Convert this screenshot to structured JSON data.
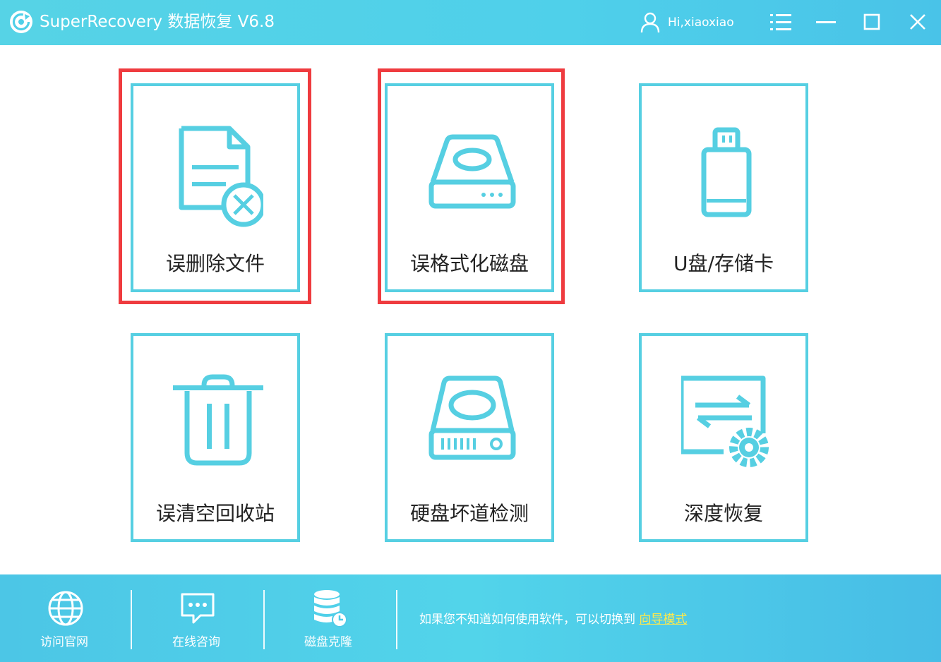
{
  "titlebar": {
    "title": "SuperRecovery 数据恢复 V6.8",
    "user": "Hi,xiaoxiao",
    "logo_icon": "refresh-circle-icon",
    "user_icon": "user-icon",
    "menu_icon": "list-menu-icon",
    "minimize_icon": "minimize-icon",
    "maximize_icon": "maximize-icon",
    "close_icon": "close-icon"
  },
  "modes": [
    {
      "label": "误删除文件",
      "icon": "deleted-file-icon",
      "highlighted": true
    },
    {
      "label": "误格式化磁盘",
      "icon": "disk-drive-icon",
      "highlighted": true
    },
    {
      "label": "U盘/存储卡",
      "icon": "usb-drive-icon",
      "highlighted": false
    },
    {
      "label": "误清空回收站",
      "icon": "trash-bin-icon",
      "highlighted": false
    },
    {
      "label": "硬盘坏道检测",
      "icon": "hard-disk-check-icon",
      "highlighted": false
    },
    {
      "label": "深度恢复",
      "icon": "deep-recovery-icon",
      "highlighted": false
    }
  ],
  "footer": {
    "tools": [
      {
        "label": "访问官网",
        "icon": "globe-icon"
      },
      {
        "label": "在线咨询",
        "icon": "chat-bubble-icon"
      },
      {
        "label": "磁盘克隆",
        "icon": "database-clone-icon"
      }
    ],
    "hint_text": "如果您不知道如何使用软件，可以切换到",
    "wizard_link": "向导模式"
  },
  "colors": {
    "accent": "#56cfe2",
    "highlight": "#ef3b3f",
    "link": "#ffe94a"
  }
}
